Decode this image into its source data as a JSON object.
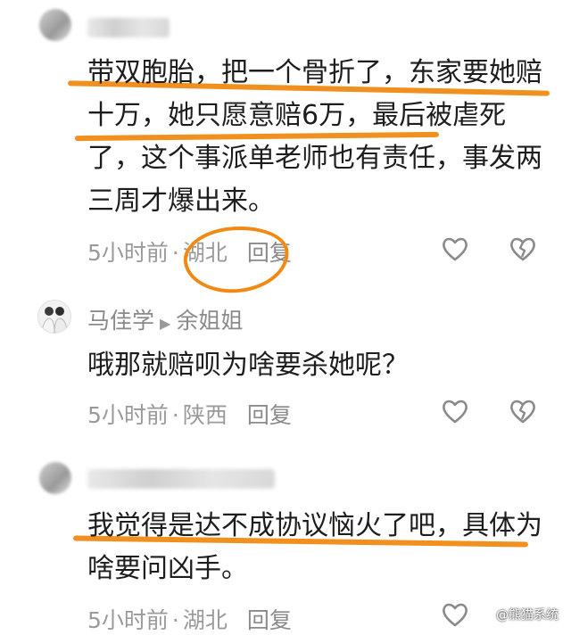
{
  "comments": [
    {
      "text": "带双胞胎，把一个骨折了，东家要她赔十万，她只愿意赔6万，最后被虐死了，这个事派单老师也有责任，事发两三周才爆出来。",
      "time": "5小时前",
      "location": "湖北",
      "reply_label": "回复"
    },
    {
      "name": "马佳学",
      "reply_to": "余姐姐",
      "text": "哦那就赔呗为啥要杀她呢？",
      "time": "5小时前",
      "location": "陕西",
      "reply_label": "回复"
    },
    {
      "text": "我觉得是达不成协议恼火了吧，具体为啥要问凶手。",
      "time": "5小时前",
      "location": "湖北",
      "reply_label": "回复"
    }
  ],
  "icons": {
    "like": "heart-outline-icon",
    "dislike": "broken-heart-outline-icon",
    "reply_arrow": "triangle-right-icon"
  },
  "watermark": {
    "text": "@熊猫系统"
  },
  "colors": {
    "highlight": "#f08a12",
    "meta": "#9a9a9a",
    "text": "#1d1d1d"
  }
}
